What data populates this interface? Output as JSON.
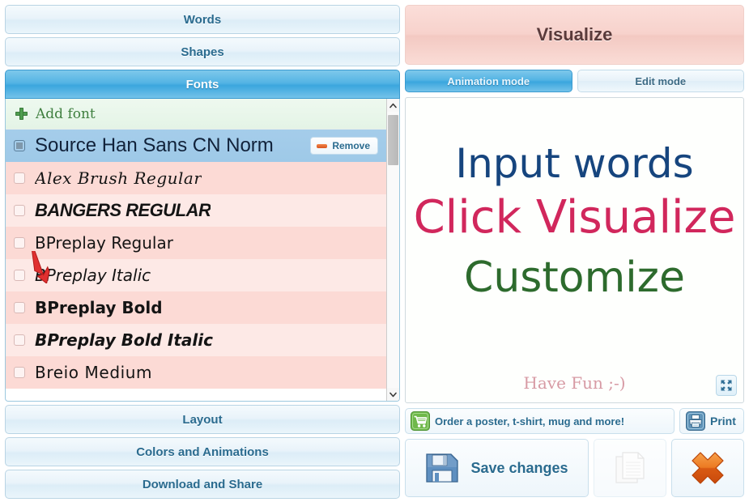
{
  "left_panel": {
    "accordion_top": [
      {
        "label": "Words",
        "active": false
      },
      {
        "label": "Shapes",
        "active": false
      },
      {
        "label": "Fonts",
        "active": true
      }
    ],
    "accordion_bottom": [
      {
        "label": "Layout",
        "active": false
      },
      {
        "label": "Colors and Animations",
        "active": false
      },
      {
        "label": "Download and Share",
        "active": false
      }
    ],
    "add_font": {
      "label": "Add font",
      "icon": "plus-icon",
      "color": "#3f7f3f"
    },
    "remove_button": {
      "label": "Remove",
      "icon": "minus-icon",
      "icon_color": "#d9541f"
    },
    "font_rows": [
      {
        "name": "Source Han Sans CN Norm",
        "checked": true,
        "selected": true,
        "style": "sel",
        "shade": "selected",
        "has_remove": true
      },
      {
        "name": "Alex Brush Regular",
        "checked": false,
        "selected": false,
        "style": "f-script",
        "shade": "shadeA",
        "has_remove": false
      },
      {
        "name": "BANGERS REGULAR",
        "checked": false,
        "selected": false,
        "style": "f-bangers",
        "shade": "shadeB",
        "has_remove": false
      },
      {
        "name": "BPreplay Regular",
        "checked": false,
        "selected": false,
        "style": "f-reg",
        "shade": "shadeA",
        "has_remove": false
      },
      {
        "name": "BPreplay Italic",
        "checked": false,
        "selected": false,
        "style": "f-ital",
        "shade": "shadeB",
        "has_remove": false
      },
      {
        "name": "BPreplay Bold",
        "checked": false,
        "selected": false,
        "style": "f-bold",
        "shade": "shadeA",
        "has_remove": false
      },
      {
        "name": "BPreplay Bold Italic",
        "checked": false,
        "selected": false,
        "style": "f-bi",
        "shade": "shadeB",
        "has_remove": false
      },
      {
        "name": "Breio Medium",
        "checked": false,
        "selected": false,
        "style": "f-hand",
        "shade": "shadeA",
        "has_remove": false
      }
    ],
    "scrollbar": {
      "up_icon": "chevron-up-icon",
      "down_icon": "chevron-down-icon"
    },
    "cursor": {
      "icon": "mouse-arrow-cursor",
      "color": "#e03030"
    }
  },
  "right_panel": {
    "visualize_label": "Visualize",
    "mode_tabs": [
      {
        "label": "Animation mode",
        "active": true
      },
      {
        "label": "Edit mode",
        "active": false
      }
    ],
    "word_cloud": {
      "words": [
        {
          "text": "Input words",
          "color": "#16457e",
          "size": 50
        },
        {
          "text": "Click Visualize",
          "color": "#d1275c",
          "size": 56
        },
        {
          "text": "Customize",
          "color": "#2d6b2d",
          "size": 52
        },
        {
          "text": "Have Fun ;-)",
          "color": "#d79aa4",
          "size": 20
        }
      ],
      "expand_icon": "fullscreen-expand-icon"
    },
    "order_button": {
      "label": "Order a poster, t-shirt, mug and more!",
      "icon": "shopping-cart-icon"
    },
    "print_button": {
      "label": "Print",
      "icon": "printer-icon"
    },
    "save_button": {
      "label": "Save changes",
      "icon": "floppy-disk-icon"
    },
    "copy_button": {
      "label": "",
      "icon": "copy-document-icon",
      "disabled": true
    },
    "close_button": {
      "label": "",
      "icon": "close-x-icon"
    }
  },
  "colors": {
    "accent_blue": "#3ba6de",
    "panel_blue": "#2a6b8f",
    "pink_row_a": "#fcdad5",
    "pink_row_b": "#fde9e6",
    "selected_row": "#9ec9e8",
    "visualize_pink": "#f7d2cc",
    "green": "#3f7f3f",
    "orange": "#d9541f"
  }
}
